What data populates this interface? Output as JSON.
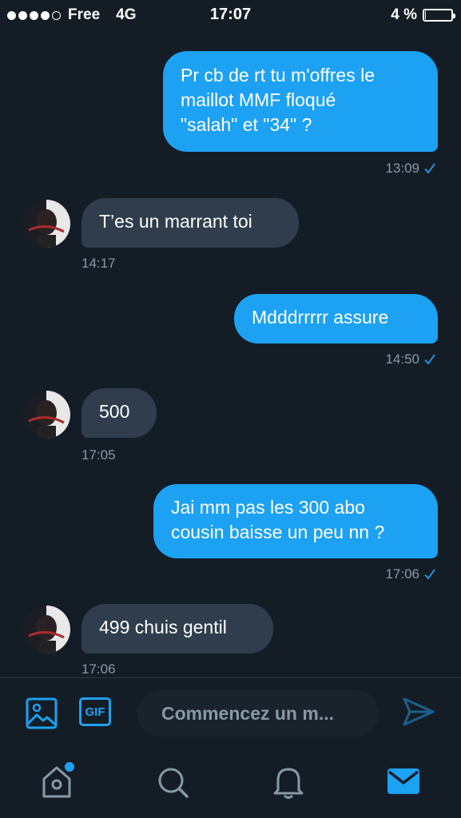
{
  "status_bar": {
    "carrier": "Free",
    "network": "4G",
    "time": "17:07",
    "battery_text": "4 %",
    "battery_level": 0.04,
    "signal_bars": 4
  },
  "messages": [
    {
      "side": "sent",
      "lines": [
        "Pr cb de rt tu m'offres le",
        "maillot MMF floqué",
        "\"salah\" et \"34\" ?"
      ],
      "time": "13:09",
      "read_icon": "check-icon"
    },
    {
      "side": "received",
      "lines": [
        "T’es un marrant toi"
      ],
      "time": "14:17"
    },
    {
      "side": "sent",
      "lines": [
        "Mdddrrrrr assure"
      ],
      "time": "14:50",
      "read_icon": "check-icon"
    },
    {
      "side": "received",
      "lines": [
        "500"
      ],
      "time": "17:05"
    },
    {
      "side": "sent",
      "lines": [
        "Jai mm pas les 300 abo",
        "cousin baisse un peu nn ?"
      ],
      "time": "17:06",
      "read_icon": "check-icon"
    },
    {
      "side": "received",
      "lines": [
        "499 chuis gentil"
      ],
      "time": "17:06"
    }
  ],
  "composer": {
    "placeholder": "Commencez un m...",
    "image_icon": "image-icon",
    "gif_label": "GIF",
    "send_icon": "send-icon"
  },
  "tab_bar": {
    "items": [
      {
        "icon": "home-icon",
        "badge": true
      },
      {
        "icon": "search-icon"
      },
      {
        "icon": "bell-icon"
      },
      {
        "icon": "mail-icon",
        "active": true
      }
    ]
  },
  "colors": {
    "background": "#141d26",
    "accent": "#1da1f2",
    "received_bubble": "#2f3d4c",
    "muted": "#8899a6"
  }
}
